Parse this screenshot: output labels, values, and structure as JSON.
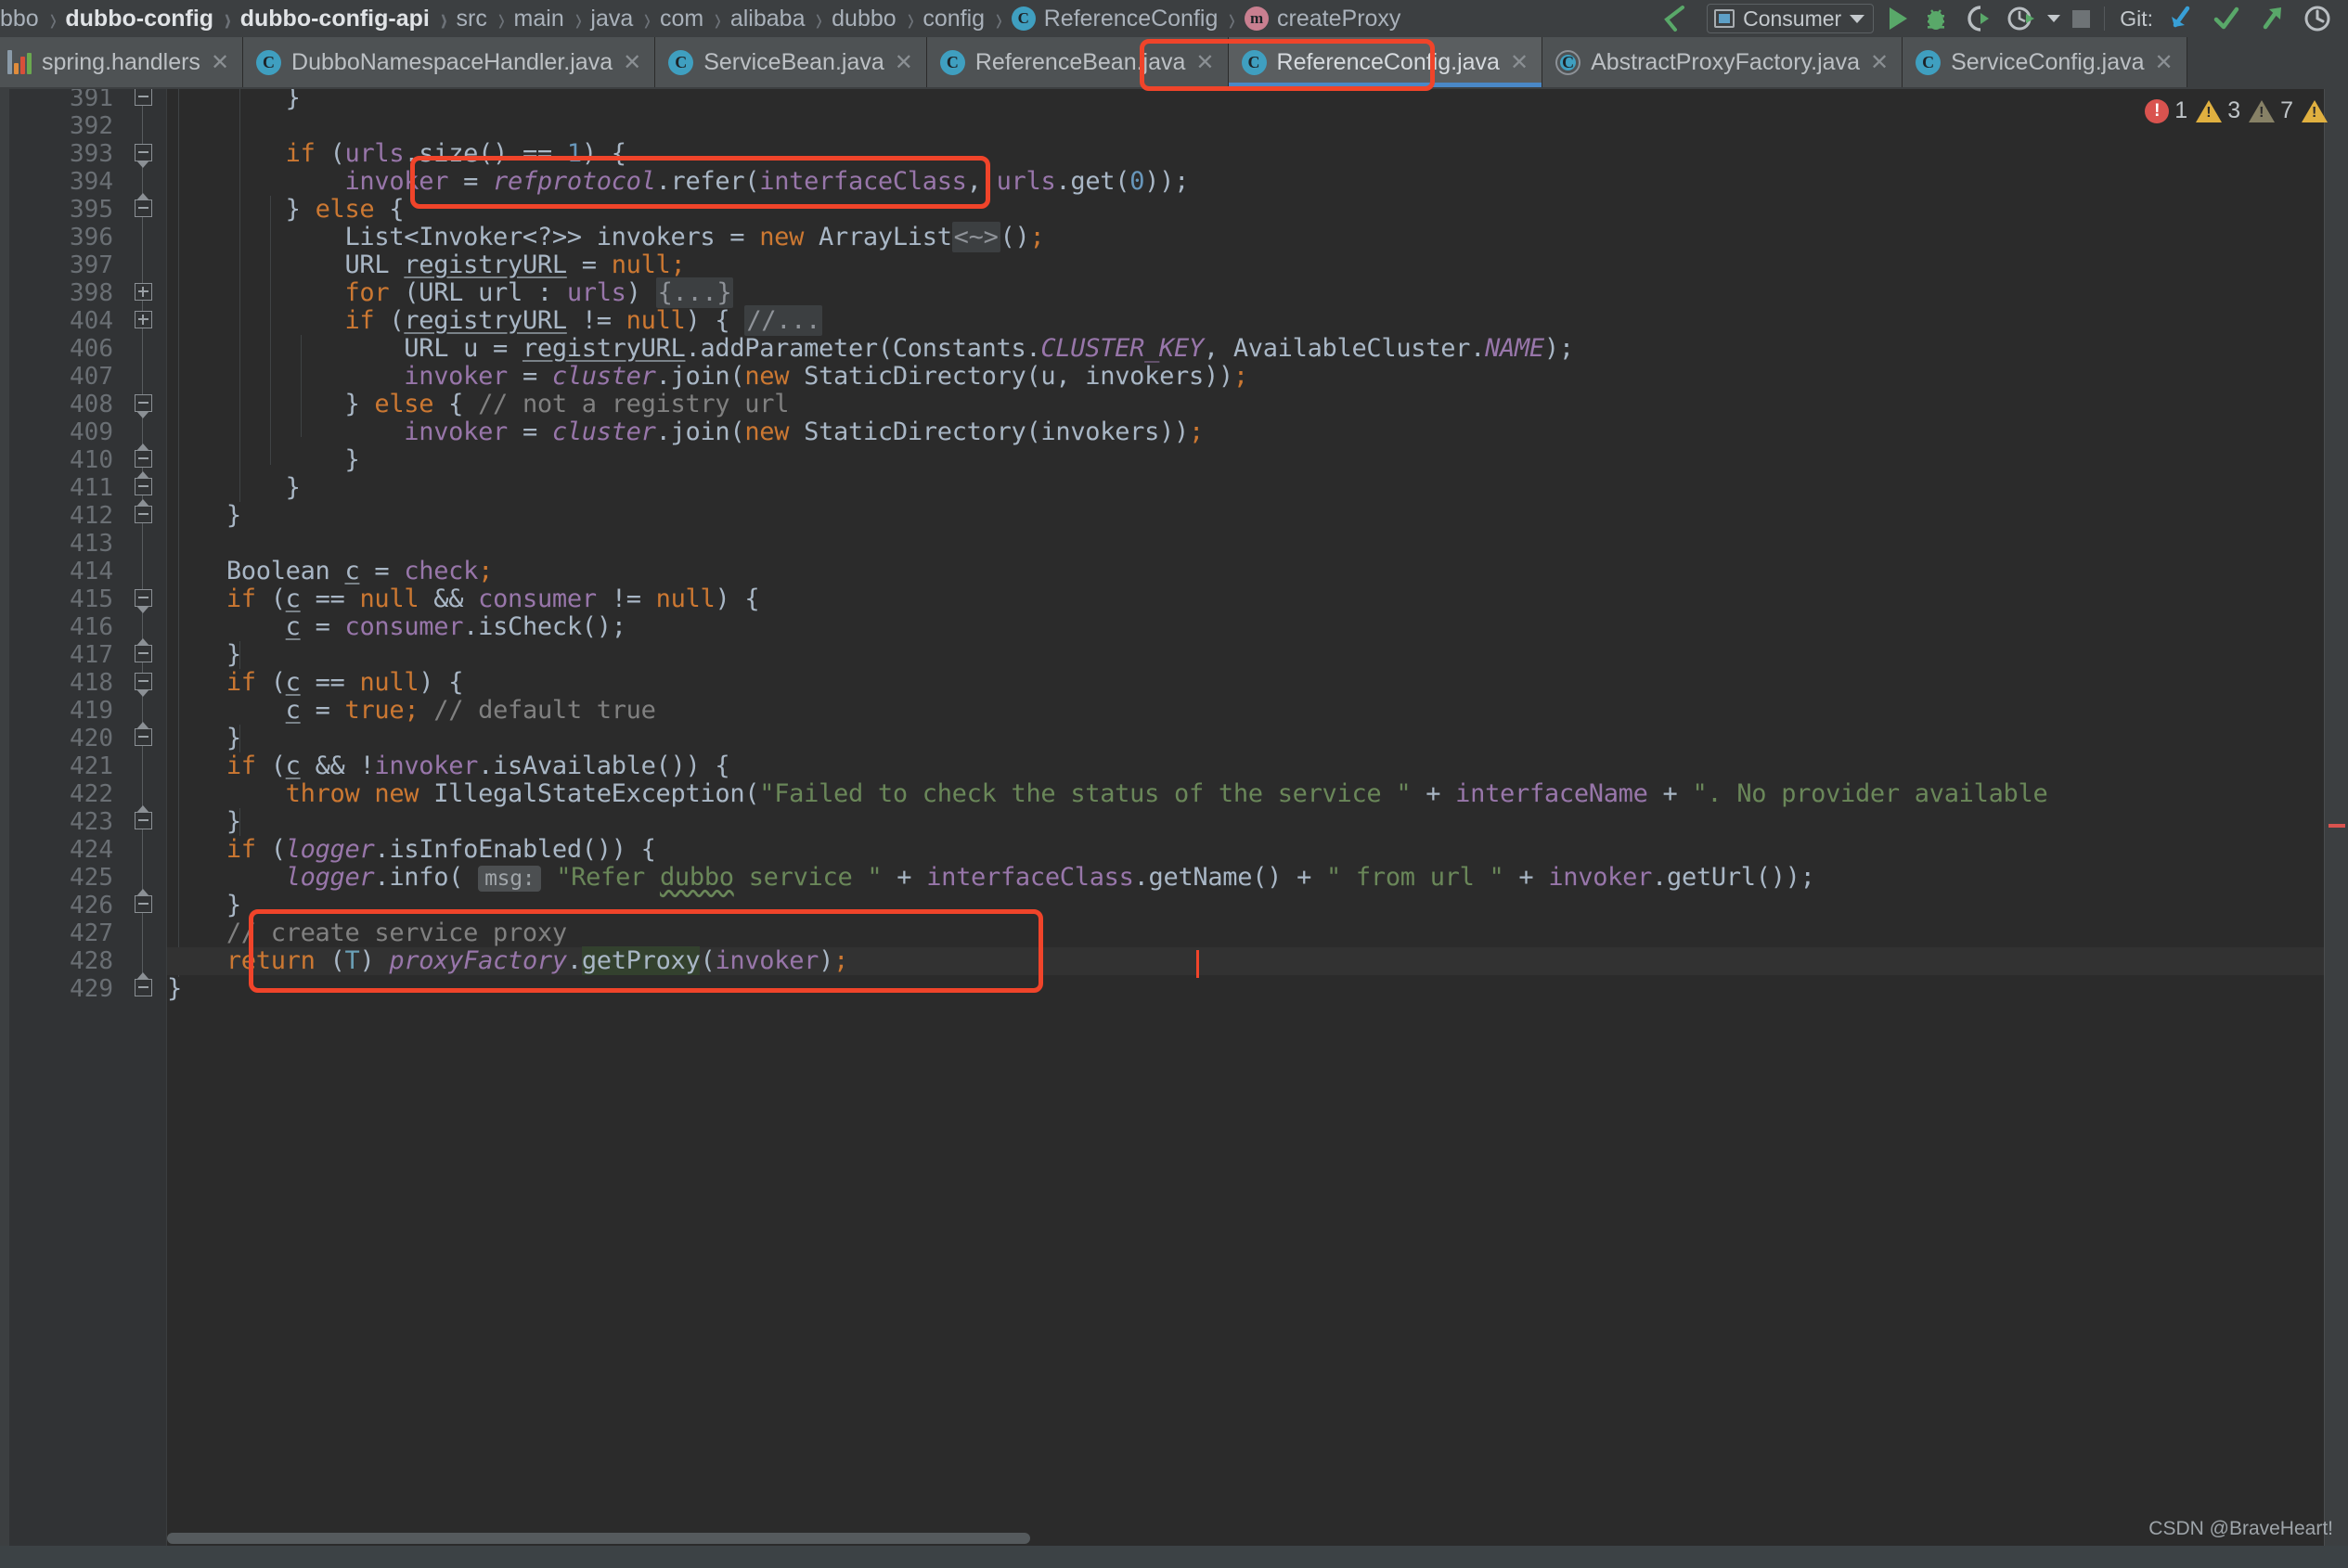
{
  "breadcrumb": {
    "items": [
      {
        "label": "bbo",
        "icon": null,
        "bold": false
      },
      {
        "label": "dubbo-config",
        "icon": null,
        "bold": true
      },
      {
        "label": "dubbo-config-api",
        "icon": null,
        "bold": true
      },
      {
        "label": "src",
        "icon": null,
        "bold": false
      },
      {
        "label": "main",
        "icon": null,
        "bold": false
      },
      {
        "label": "java",
        "icon": null,
        "bold": false
      },
      {
        "label": "com",
        "icon": null,
        "bold": false
      },
      {
        "label": "alibaba",
        "icon": null,
        "bold": false
      },
      {
        "label": "dubbo",
        "icon": null,
        "bold": false
      },
      {
        "label": "config",
        "icon": null,
        "bold": false
      },
      {
        "label": "ReferenceConfig",
        "icon": "class-icon",
        "bold": false
      },
      {
        "label": "createProxy",
        "icon": "method-icon",
        "bold": false
      }
    ]
  },
  "toolbar": {
    "back_icon": "back-arrow-icon",
    "run_configuration": "Consumer",
    "run_config_icon": "run-configuration-icon",
    "dropdown_icon": "chevron-down-icon",
    "run_icon": "run-icon",
    "debug_icon": "debug-icon",
    "run_coverage_icon": "run-with-coverage-icon",
    "profile_icon": "profiler-icon",
    "profile_dropdown_icon": "chevron-down-icon",
    "stop_icon": "stop-icon",
    "git_label": "Git:",
    "git_update_icon": "update-project-icon",
    "git_commit_icon": "commit-icon",
    "git_push_icon": "push-icon",
    "git_history_icon": "history-icon"
  },
  "tabs": [
    {
      "label": "spring.handlers",
      "icon": "xml-file-icon",
      "active": false,
      "close_icon": "close-icon"
    },
    {
      "label": "DubboNamespaceHandler.java",
      "icon": "java-class-icon",
      "active": false,
      "close_icon": "close-icon"
    },
    {
      "label": "ServiceBean.java",
      "icon": "java-class-icon",
      "active": false,
      "close_icon": "close-icon"
    },
    {
      "label": "ReferenceBean.java",
      "icon": "java-class-icon",
      "active": false,
      "close_icon": "close-icon"
    },
    {
      "label": "ReferenceConfig.java",
      "icon": "java-class-icon",
      "active": true,
      "close_icon": "close-icon"
    },
    {
      "label": "AbstractProxyFactory.java",
      "icon": "java-abstract-class-icon",
      "active": false,
      "close_icon": "close-icon"
    },
    {
      "label": "ServiceConfig.java",
      "icon": "java-class-icon",
      "active": false,
      "close_icon": "close-icon"
    }
  ],
  "inspections": {
    "errors": "1",
    "warnings": "3",
    "weak_warnings": "7",
    "error_icon": "error-icon",
    "warning_icon": "warning-icon",
    "weak_warning_icon": "weak-warning-icon",
    "extra_warning_icon": "warning-icon"
  },
  "gutter": {
    "line_numbers": [
      "391",
      "392",
      "393",
      "394",
      "395",
      "396",
      "397",
      "398",
      "404",
      "406",
      "407",
      "408",
      "409",
      "410",
      "411",
      "412",
      "413",
      "414",
      "415",
      "416",
      "417",
      "418",
      "419",
      "420",
      "421",
      "422",
      "423",
      "424",
      "425",
      "426",
      "427",
      "428",
      "429"
    ]
  },
  "code": {
    "lines": [
      {
        "n": "391",
        "text": "        }"
      },
      {
        "n": "392",
        "text": ""
      },
      {
        "n": "393",
        "text": "        if (urls.size() == 1) {"
      },
      {
        "n": "394",
        "text": "            invoker = refprotocol.refer(interfaceClass, urls.get(0));"
      },
      {
        "n": "395",
        "text": "        } else {"
      },
      {
        "n": "396",
        "text": "            List<Invoker<?>> invokers = new ArrayList<~>();"
      },
      {
        "n": "397",
        "text": "            URL registryURL = null;"
      },
      {
        "n": "398",
        "text": "            for (URL url : urls) {...}"
      },
      {
        "n": "404",
        "text": "            if (registryURL != null) { //..."
      },
      {
        "n": "406",
        "text": "                URL u = registryURL.addParameter(Constants.CLUSTER_KEY, AvailableCluster.NAME);"
      },
      {
        "n": "407",
        "text": "                invoker = cluster.join(new StaticDirectory(u, invokers));"
      },
      {
        "n": "408",
        "text": "            } else { // not a registry url"
      },
      {
        "n": "409",
        "text": "                invoker = cluster.join(new StaticDirectory(invokers));"
      },
      {
        "n": "410",
        "text": "            }"
      },
      {
        "n": "411",
        "text": "        }"
      },
      {
        "n": "412",
        "text": "    }"
      },
      {
        "n": "413",
        "text": ""
      },
      {
        "n": "414",
        "text": "    Boolean c = check;"
      },
      {
        "n": "415",
        "text": "    if (c == null && consumer != null) {"
      },
      {
        "n": "416",
        "text": "        c = consumer.isCheck();"
      },
      {
        "n": "417",
        "text": "    }"
      },
      {
        "n": "418",
        "text": "    if (c == null) {"
      },
      {
        "n": "419",
        "text": "        c = true; // default true"
      },
      {
        "n": "420",
        "text": "    }"
      },
      {
        "n": "421",
        "text": "    if (c && !invoker.isAvailable()) {"
      },
      {
        "n": "422",
        "text": "        throw new IllegalStateException(\"Failed to check the status of the service \" + interfaceName + \". No provider available"
      },
      {
        "n": "423",
        "text": "    }"
      },
      {
        "n": "424",
        "text": "    if (logger.isInfoEnabled()) {"
      },
      {
        "n": "425",
        "text": "        logger.info( msg: \"Refer dubbo service \" + interfaceClass.getName() + \" from url \" + invoker.getUrl());"
      },
      {
        "n": "426",
        "text": "    }"
      },
      {
        "n": "427",
        "text": "    // create service proxy"
      },
      {
        "n": "428",
        "text": "    return (T) proxyFactory.getProxy(invoker);"
      },
      {
        "n": "429",
        "text": "}"
      }
    ],
    "parameter_hint": "msg:",
    "annotations": [
      {
        "name": "refer-call-highlight",
        "line": "394",
        "color": "#f0442a"
      },
      {
        "name": "create-proxy-highlight",
        "lines": "427-428",
        "color": "#f0442a"
      }
    ]
  },
  "watermark": "CSDN @BraveHeart!",
  "colors": {
    "editor_background": "#2b2b2b",
    "gutter_background": "#313335",
    "chrome_background": "#3c3f41",
    "keyword": "#cc7832",
    "string": "#6a8759",
    "number": "#6897bb",
    "comment": "#808080",
    "field": "#9876aa",
    "default_text": "#a9b7c6",
    "highlight_box": "#f0442a",
    "active_tab_underline": "#4a88c7"
  }
}
